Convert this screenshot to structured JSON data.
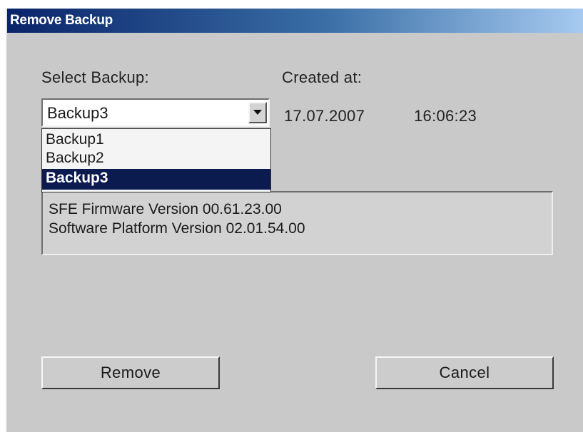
{
  "window": {
    "title": "Remove Backup"
  },
  "labels": {
    "select_backup": "Select Backup:",
    "created_at": "Created at:"
  },
  "backup_select": {
    "selected_value": "Backup3",
    "options": [
      "Backup1",
      "Backup2",
      "Backup3"
    ],
    "highlighted_index": 2
  },
  "created": {
    "date": "17.07.2007",
    "time": "16:06:23"
  },
  "info": {
    "lines": [
      "SFE Firmware Version 00.61.23.00",
      "Software Platform Version 02.01.54.00"
    ]
  },
  "buttons": {
    "remove": "Remove",
    "cancel": "Cancel"
  },
  "colors": {
    "titlebar_start": "#0a246a",
    "titlebar_end": "#a6caf0",
    "selection": "#0b1a4f",
    "dialog_background": "#c9c9c9"
  }
}
